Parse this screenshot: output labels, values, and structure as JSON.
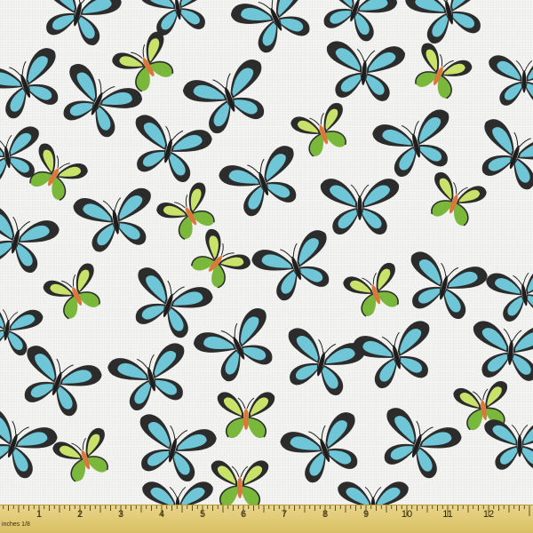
{
  "colors": {
    "background": "#f4f4f3",
    "blue_wing": "#6fc6d6",
    "blue_wing_dark": "#2c2c2c",
    "green_wing_light": "#c9e26a",
    "green_wing_mid": "#79b83a",
    "green_wing_dark": "#2b2b2b",
    "orange_body": "#d9783a",
    "ruler": "#e1c873"
  },
  "icons": {
    "blue_butterfly": "blue-swallowtail-butterfly-icon",
    "green_butterfly": "green-birdwing-butterfly-icon"
  },
  "ruler": {
    "units_label": "inches 1/8",
    "numbers": [
      "1",
      "2",
      "3",
      "4",
      "5",
      "6",
      "7",
      "8",
      "9",
      "10",
      "11",
      "12"
    ]
  }
}
